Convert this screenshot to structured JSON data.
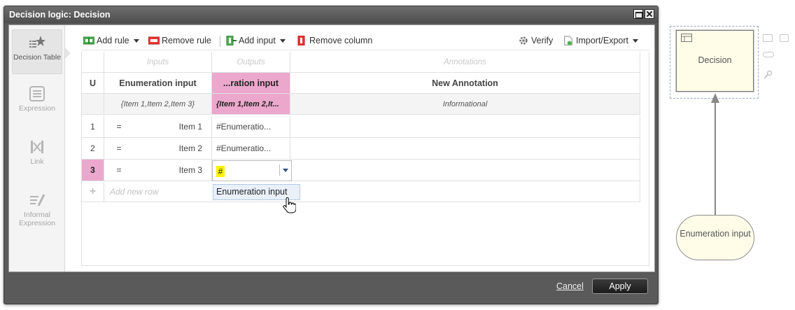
{
  "dialog": {
    "title": "Decision logic: Decision",
    "cancel_label": "Cancel",
    "apply_label": "Apply"
  },
  "rail": {
    "items": [
      {
        "label": "Decision Table",
        "icon": "decision-table-icon",
        "active": true
      },
      {
        "label": "Expression",
        "icon": "expression-icon",
        "active": false
      },
      {
        "label": "Link",
        "icon": "link-icon",
        "active": false
      },
      {
        "label": "Informal Expression",
        "icon": "informal-expression-icon",
        "active": false
      }
    ]
  },
  "toolbar": {
    "add_rule": "Add rule",
    "remove_rule": "Remove rule",
    "add_input": "Add input",
    "remove_column": "Remove column",
    "verify": "Verify",
    "import_export": "Import/Export"
  },
  "table": {
    "groups": {
      "inputs": "Inputs",
      "outputs": "Outputs",
      "annotations": "Annotations"
    },
    "headers": {
      "u": "U",
      "input": "Enumeration input",
      "output": "...ration input",
      "annotation": "New Annotation"
    },
    "subheaders": {
      "input": "{Item 1,Item 2,Item 3}",
      "output": "{Item 1,Item 2,It...",
      "annotation": "Informational"
    },
    "rows": [
      {
        "num": "1",
        "op": "=",
        "input": "Item 1",
        "output": "#Enumeratio..."
      },
      {
        "num": "2",
        "op": "=",
        "input": "Item 2",
        "output": "#Enumeratio..."
      },
      {
        "num": "3",
        "op": "=",
        "input": "Item 3",
        "output": "#"
      }
    ],
    "add_row": "Add new row",
    "dropdown_option": "Enumeration input"
  },
  "diagram": {
    "decision_label": "Decision",
    "input_label": "Enumeration input"
  },
  "colors": {
    "selected_pink": "#eba8cc",
    "highlight_yellow": "#fff200",
    "node_fill": "#fffde8"
  }
}
